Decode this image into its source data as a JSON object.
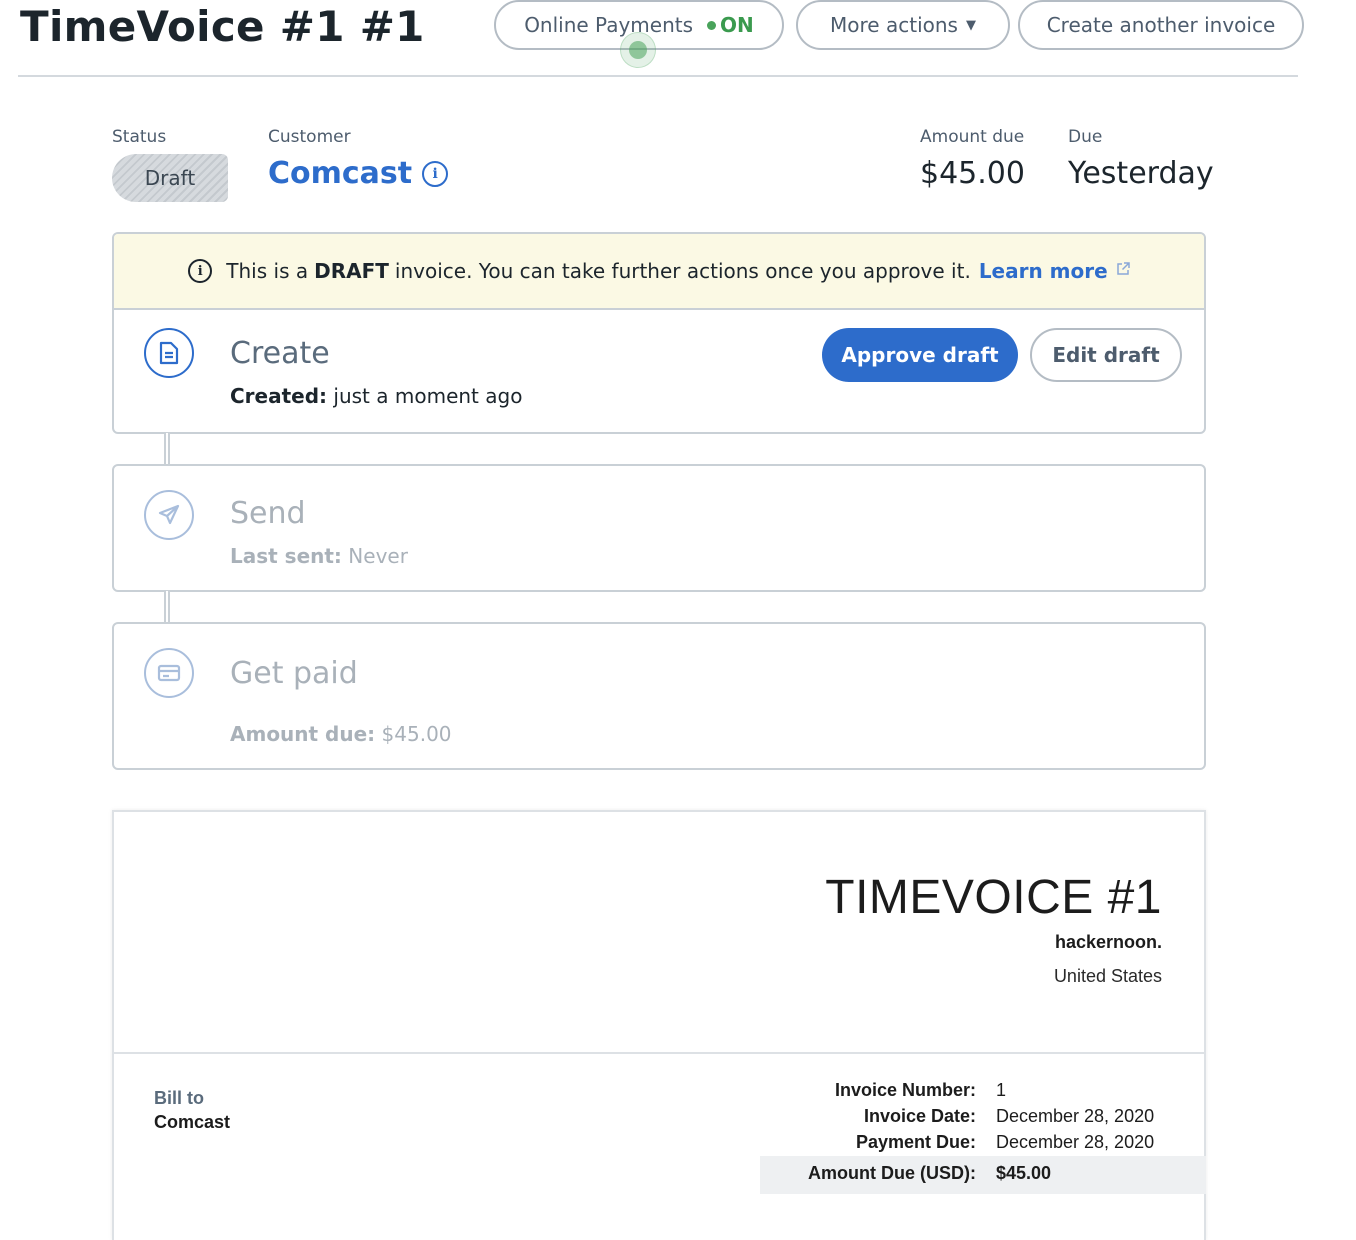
{
  "header": {
    "title": "TimeVoice #1 #1",
    "online_payments_label": "Online Payments",
    "online_payments_state": "ON",
    "more_actions_label": "More actions",
    "create_another_label": "Create another invoice"
  },
  "summary": {
    "status_label": "Status",
    "status_value": "Draft",
    "customer_label": "Customer",
    "customer_name": "Comcast",
    "amount_due_label": "Amount due",
    "amount_due_value": "$45.00",
    "due_label": "Due",
    "due_value": "Yesterday"
  },
  "banner": {
    "text_before": "This is a",
    "text_bold": "DRAFT",
    "text_after": "invoice. You can take further actions once you approve it.",
    "learn_more": "Learn more"
  },
  "steps": {
    "create": {
      "title": "Create",
      "sub_label": "Created:",
      "sub_value": "just a moment ago",
      "approve_label": "Approve draft",
      "edit_label": "Edit draft"
    },
    "send": {
      "title": "Send",
      "sub_label": "Last sent:",
      "sub_value": "Never"
    },
    "get_paid": {
      "title": "Get paid",
      "sub_label": "Amount due:",
      "sub_value": "$45.00"
    }
  },
  "invoice": {
    "title": "TIMEVOICE #1",
    "company": "hackernoon.",
    "country": "United States",
    "bill_to_label": "Bill to",
    "bill_to_name": "Comcast",
    "meta": [
      {
        "label": "Invoice Number:",
        "value": "1"
      },
      {
        "label": "Invoice Date:",
        "value": "December 28, 2020"
      },
      {
        "label": "Payment Due:",
        "value": "December 28, 2020"
      }
    ],
    "total": {
      "label": "Amount Due (USD):",
      "value": "$45.00"
    }
  },
  "colors": {
    "accent": "#2d6ccb",
    "on_green": "#3a9a4e",
    "banner_bg": "#fbf9e4",
    "text": "#1c252c",
    "muted": "#4d5c6d"
  },
  "icons": {
    "create": "document-icon",
    "send": "paper-plane-icon",
    "get_paid": "credit-card-icon",
    "info": "info-icon",
    "external": "external-link-icon",
    "caret": "caret-down-icon"
  }
}
